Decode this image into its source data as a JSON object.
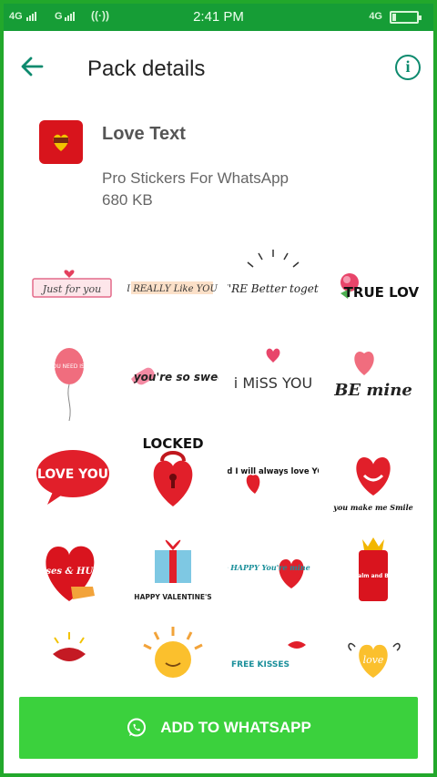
{
  "status_bar": {
    "left_signal_1": "4G",
    "left_signal_2": "G",
    "time": "2:41 PM",
    "right_network": "4G",
    "battery_level": 0.15
  },
  "app_bar": {
    "title": "Pack details",
    "back_icon": "arrow-left-icon",
    "info_icon": "info-icon"
  },
  "pack": {
    "name": "Love Text",
    "publisher": "Pro Stickers For WhatsApp",
    "size": "680 KB"
  },
  "stickers": [
    {
      "label": "Just for you"
    },
    {
      "label": "I REALLY Like YOU"
    },
    {
      "label": "WE'RE Better together"
    },
    {
      "label": "TRUE LOVE"
    },
    {
      "label": "ALL YOU NEED IS LOVE"
    },
    {
      "label": "you're so sweet"
    },
    {
      "label": "i MiSS YOU"
    },
    {
      "label": "BE mine"
    },
    {
      "label": "LOVE YOU"
    },
    {
      "label": "LOCKED"
    },
    {
      "label": "and I will always love YOU"
    },
    {
      "label": "you make me Smile"
    },
    {
      "label": "kisses & HUGS"
    },
    {
      "label": "HAPPY VALENTINE'S"
    },
    {
      "label": "So HAPPY You're mine"
    },
    {
      "label": "KEEP calm and BE mine"
    },
    {
      "label": "lips"
    },
    {
      "label": "sun"
    },
    {
      "label": "FREE KISSES"
    },
    {
      "label": "love"
    }
  ],
  "add_button": {
    "label": "ADD TO WHATSAPP",
    "icon": "whatsapp-icon"
  },
  "colors": {
    "status_bar": "#169d36",
    "accent": "#0d8a6e",
    "button": "#3bd13d",
    "frame": "#22a82b"
  }
}
